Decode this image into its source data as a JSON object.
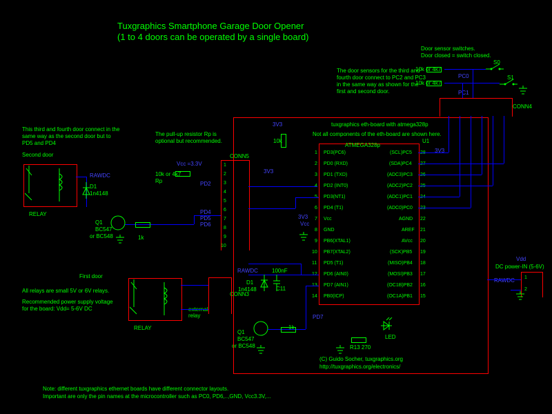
{
  "title": "Tuxgraphics Smartphone Garage Door Opener",
  "subtitle": "(1 to 4 doors can be operated by a single board)",
  "door_sensor_title": "Door sensor switches.",
  "door_sensor_sub": "Door closed = switch closed.",
  "r_pullup": "10k or 4k7",
  "sw0": "S0",
  "sw1": "S1",
  "pc0": "PC0",
  "pc1": "PC1",
  "conn4": "CONN4",
  "door_sensor_note1": "The door sensors for the third and",
  "door_sensor_note2": "fourth door connect to PC2 and PC3",
  "door_sensor_note3": "in the same way as shown for the",
  "door_sensor_note4": "first and second door.",
  "doors_note1": "This third and fourth door connect in the",
  "doors_note2": "same way as the second door but to",
  "doors_note3": "PD5 and PD4",
  "second_door": "Second door",
  "first_door": "First door",
  "relay_note1": "All relays are small 5V or 6V relays.",
  "relay_note2": "Recommended power supply voltage",
  "relay_note3": "for the board: Vdd= 5-6V DC",
  "relay": "RELAY",
  "rawdc": "RAWDC",
  "d1": "D1",
  "d1_part": "1n4148",
  "q1": "Q1",
  "q1_part": "BC547",
  "q1_alt": "or BC548",
  "r1k": "1k",
  "r10k": "10k",
  "pullup_note1": "The pull-up resistor Rp is",
  "pullup_note2": "optional but recommended.",
  "rp": "Rp",
  "vcc33": "Vcc =3.3V",
  "v3v3": "3V3",
  "conn5": "CONN5",
  "conn3": "CONN3",
  "pd2": "PD2",
  "pd4": "PD4",
  "pd5": "PD5",
  "pd6": "PD6",
  "pd7": "PD7",
  "ext_relay": "external\nrelay",
  "c11": "C11",
  "c11_val": "100nF",
  "board_title": "tuxgraphics eth-board with atmega328p",
  "board_sub": "Not all components of the eth-board are shown here.",
  "mcu": "ATMEGA328p",
  "u1": "U1",
  "vcc": "Vcc",
  "gnd": "GND",
  "led": "LED",
  "r13": "R13  270",
  "dcpower": "DC power-IN (5-6V)",
  "vdd": "Vdd",
  "copyright": "(C) Guido Socher, tuxgraphics.org",
  "url": "http://tuxgraphics.org/electronics/",
  "footer1": "Note: different tuxgraphics ethernet boards have different connector layouts.",
  "footer2": "Important are only the pin names at the microcontroller such as PC0, PD6,..,GND, Vcc3.3V,...",
  "pins": {
    "p1": "PD3(PC6)",
    "p1r": "(SCL)PC5",
    "p2": "PD0 (RXD)",
    "p2r": "(SDA)PC4",
    "p3": "PD1 (TXD)",
    "p3r": "(ADC3)PC3",
    "p4": "PD2 (INT0)",
    "p4r": "(ADC2)PC2",
    "p5": "PD3(NT1)",
    "p5r": "(ADC1)PC1",
    "p6": "PD4 (T1)",
    "p6r": "(ADC0)PC0",
    "p7": "Vcc",
    "p7r": "AGND",
    "p8": "GND",
    "p8r": "AREF",
    "p9": "PB6(XTAL1)",
    "p9r": "AVcc",
    "p10": "PB7(XTAL2)",
    "p10r": "(SCK)PB5",
    "p11": "PD5 (T1)",
    "p11r": "(MISO)PB4",
    "p12": "PD6 (AIN0)",
    "p12r": "(MOSI)PB3",
    "p13": "PD7 (AIN1)",
    "p13r": "(OC1B)PB2",
    "p14": "PB0(ICP)",
    "p14r": "(OC1A)PB1"
  },
  "pn": {
    "n1": "1",
    "n2": "2",
    "n3": "3",
    "n4": "4",
    "n5": "5",
    "n6": "6",
    "n7": "7",
    "n8": "8",
    "n9": "9",
    "n10": "10",
    "n11": "11",
    "n12": "12",
    "n13": "13",
    "n14": "14",
    "n15": "15",
    "n16": "16",
    "n17": "17",
    "n18": "18",
    "n19": "19",
    "n20": "20",
    "n21": "21",
    "n22": "22",
    "n23": "23",
    "n24": "24",
    "n25": "25",
    "n26": "26",
    "n27": "27",
    "n28": "28"
  }
}
